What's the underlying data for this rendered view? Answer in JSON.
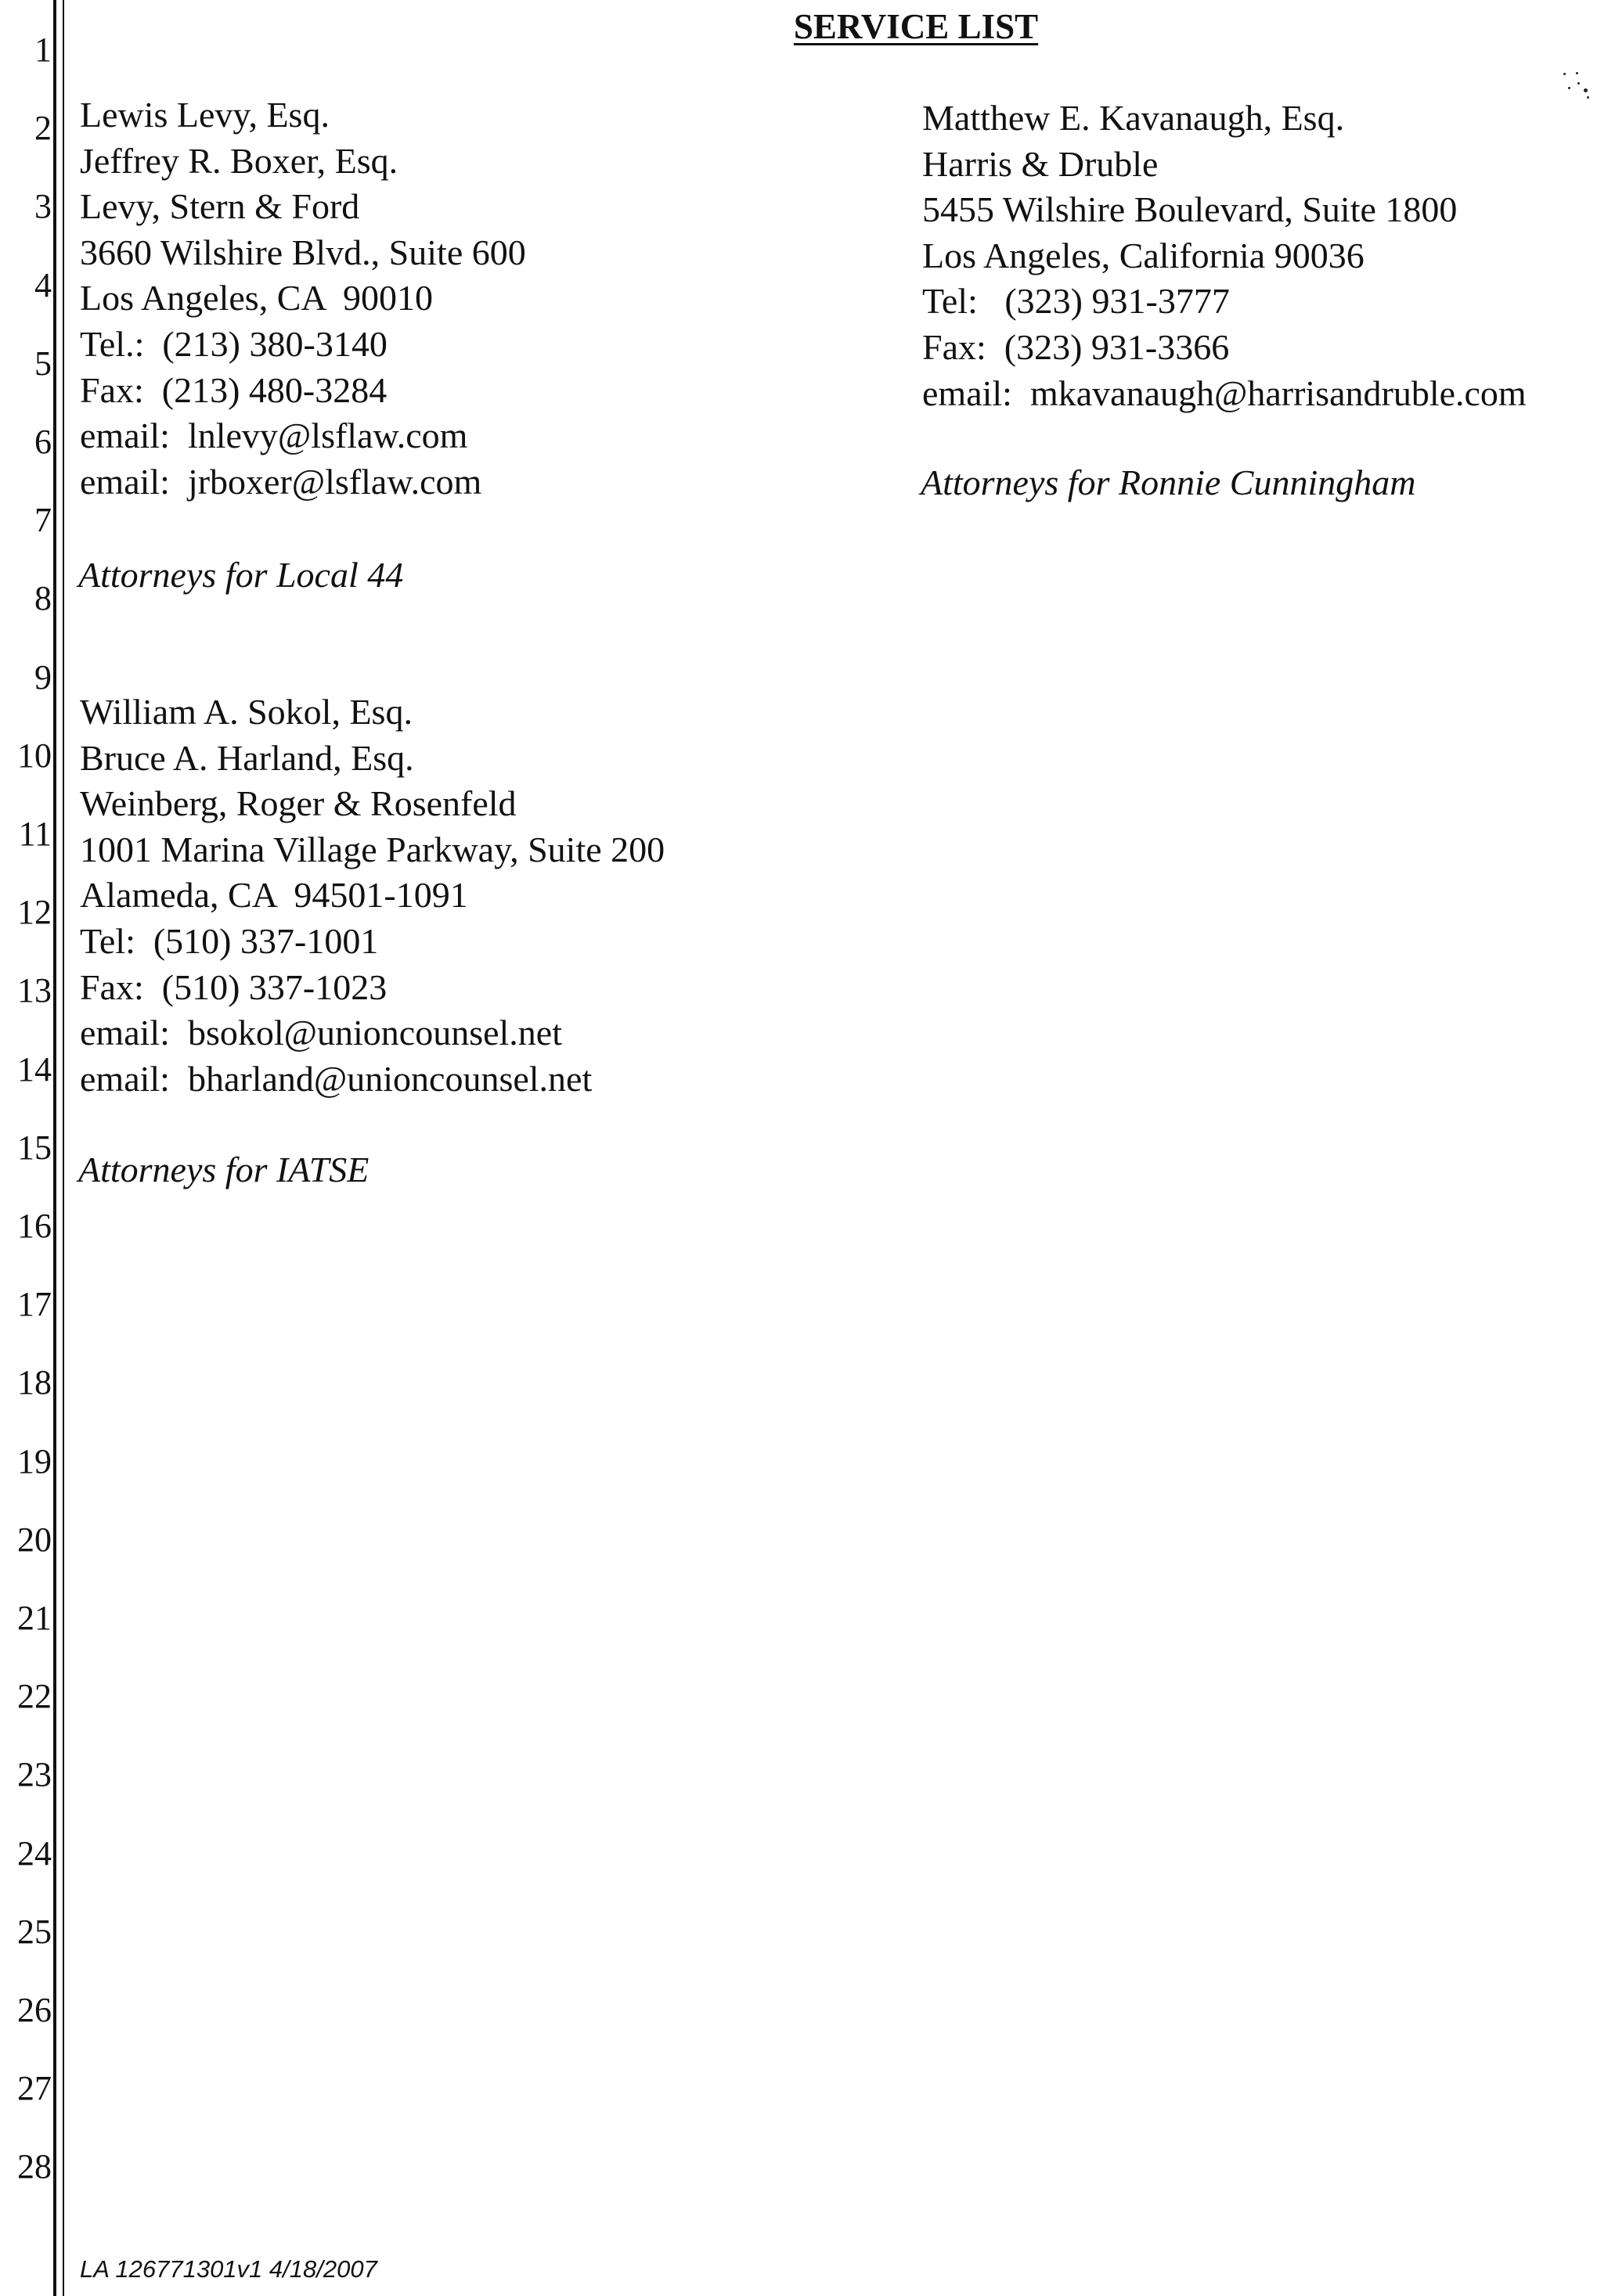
{
  "document": {
    "title": "SERVICE LIST",
    "line_numbers": [
      "1",
      "2",
      "3",
      "4",
      "5",
      "6",
      "7",
      "8",
      "9",
      "10",
      "11",
      "12",
      "13",
      "14",
      "15",
      "16",
      "17",
      "18",
      "19",
      "20",
      "21",
      "22",
      "23",
      "24",
      "25",
      "26",
      "27",
      "28"
    ],
    "entries": [
      {
        "lines": [
          "Lewis Levy, Esq.",
          "Jeffrey R. Boxer, Esq.",
          "Levy, Stern & Ford",
          "3660 Wilshire Blvd., Suite 600",
          "Los Angeles, CA  90010",
          "Tel.:  (213) 380-3140",
          "Fax:  (213) 480-3284",
          "email:  lnlevy@lsflaw.com",
          "email:  jrboxer@lsflaw.com"
        ],
        "role": "Attorneys for Local 44"
      },
      {
        "lines": [
          "William A. Sokol, Esq.",
          "Bruce A. Harland, Esq.",
          "Weinberg, Roger & Rosenfeld",
          "1001 Marina Village Parkway, Suite 200",
          "Alameda, CA  94501-1091",
          "Tel:  (510) 337-1001",
          "Fax:  (510) 337-1023",
          "email:  bsokol@unioncounsel.net",
          "email:  bharland@unioncounsel.net"
        ],
        "role": "Attorneys for IATSE"
      },
      {
        "lines": [
          "Matthew E. Kavanaugh, Esq.",
          "Harris & Druble",
          "5455 Wilshire Boulevard, Suite 1800",
          "Los Angeles, California 90036",
          "Tel:   (323) 931-3777",
          "Fax:  (323) 931-3366",
          "email:  mkavanaugh@harrisandruble.com"
        ],
        "role": "Attorneys for Ronnie Cunningham"
      }
    ],
    "footer": "LA 126771301v1 4/18/2007"
  }
}
